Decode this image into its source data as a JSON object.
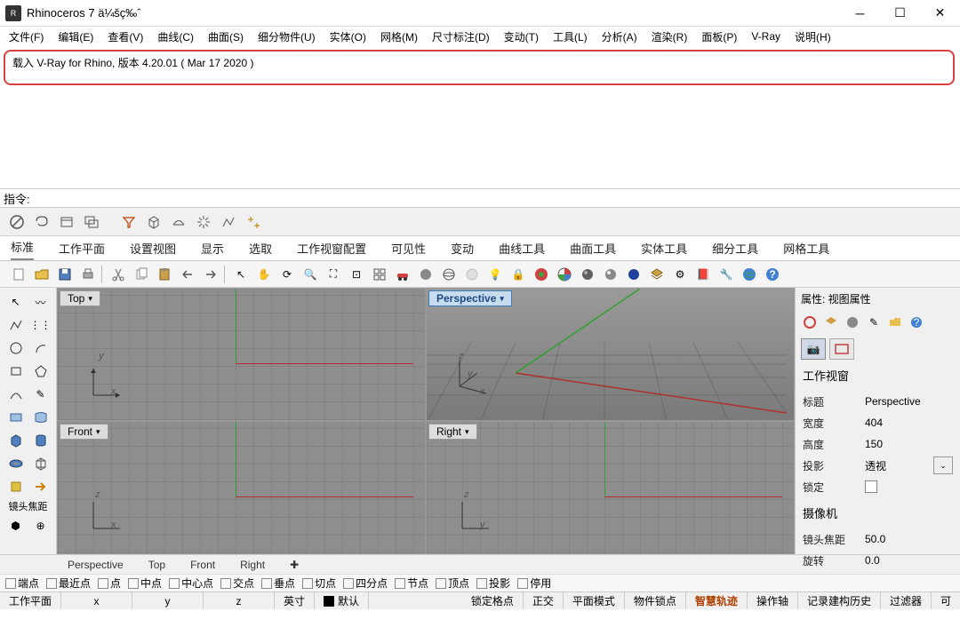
{
  "titlebar": {
    "title": "Rhinoceros 7 ä¼šç‰ˆ"
  },
  "menubar": [
    "文件(F)",
    "编辑(E)",
    "查看(V)",
    "曲线(C)",
    "曲面(S)",
    "细分物件(U)",
    "实体(O)",
    "网格(M)",
    "尺寸标注(D)",
    "变动(T)",
    "工具(L)",
    "分析(A)",
    "渲染(R)",
    "面板(P)",
    "V-Ray",
    "说明(H)"
  ],
  "console": {
    "line1": "载入 V-Ray for Rhino, 版本 4.20.01 ( Mar 17 2020 )"
  },
  "command": {
    "label": "指令:"
  },
  "tabs": [
    "标准",
    "工作平面",
    "设置视图",
    "显示",
    "选取",
    "工作视窗配置",
    "可见性",
    "变动",
    "曲线工具",
    "曲面工具",
    "实体工具",
    "细分工具",
    "网格工具"
  ],
  "viewports": {
    "top": "Top",
    "front": "Front",
    "perspective": "Perspective",
    "right": "Right",
    "axis_x": "x",
    "axis_y": "y",
    "axis_z": "z"
  },
  "right_panel": {
    "title": "属性: 视图属性",
    "section1": "工作视窗",
    "fields": {
      "title_label": "标题",
      "title_value": "Perspective",
      "width_label": "宽度",
      "width_value": "404",
      "height_label": "高度",
      "height_value": "150",
      "proj_label": "投影",
      "proj_value": "透视",
      "lock_label": "锁定"
    },
    "section2": "摄像机",
    "focal_label": "镜头焦距",
    "focal_value": "50.0",
    "rot_label": "旋转",
    "rot_value": "0.0"
  },
  "left_tools": {
    "focal": "镜头焦距"
  },
  "bottom_tabs": [
    "Perspective",
    "Top",
    "Front",
    "Right"
  ],
  "osnaps": [
    "端点",
    "最近点",
    "点",
    "中点",
    "中心点",
    "交点",
    "垂点",
    "切点",
    "四分点",
    "节点",
    "顶点",
    "投影",
    "停用"
  ],
  "status": {
    "items": [
      "工作平面",
      "x",
      "y",
      "z",
      "英寸",
      "默认"
    ],
    "right": [
      "锁定格点",
      "正交",
      "平面模式",
      "物件锁点",
      "智慧轨迹",
      "操作轴",
      "记录建构历史",
      "过滤器",
      "可"
    ]
  }
}
